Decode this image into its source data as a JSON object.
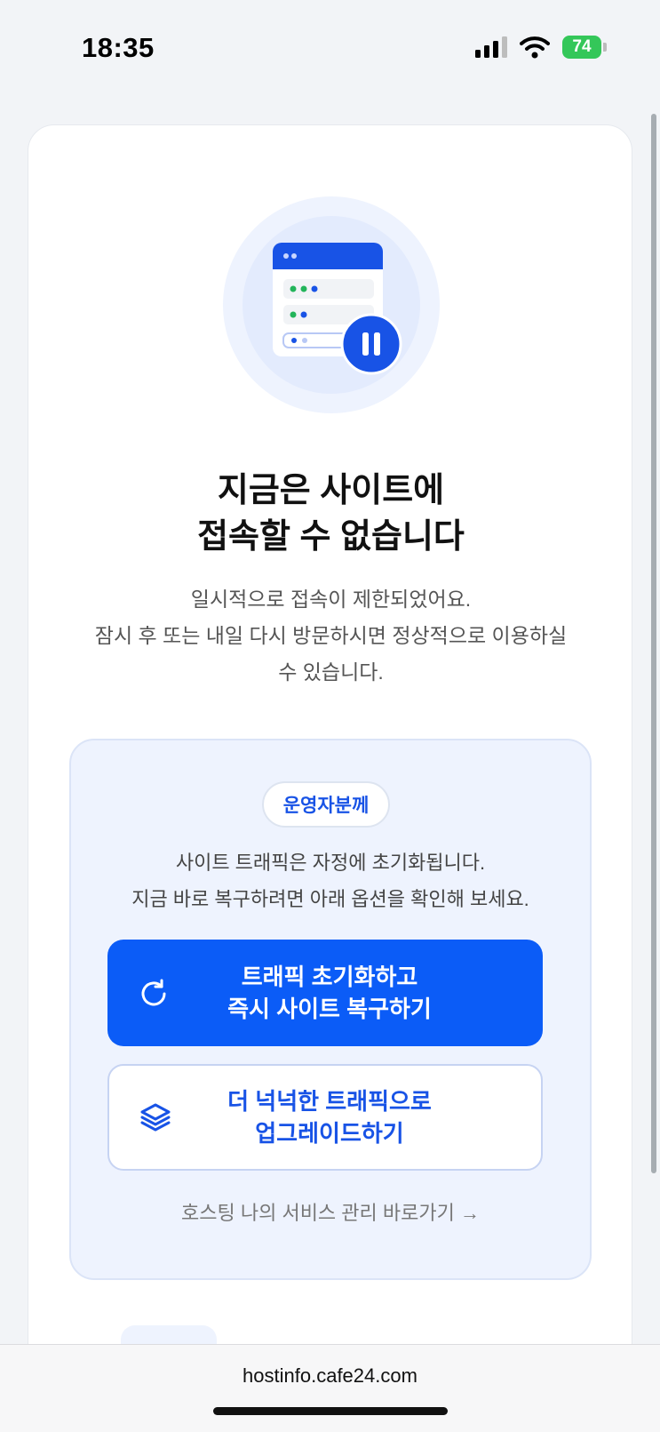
{
  "status_bar": {
    "time": "18:35",
    "battery": "74",
    "icons": [
      "signal-icon",
      "wifi-icon",
      "battery-charging-icon"
    ]
  },
  "hero": {
    "icon": "paused-browser-window-icon"
  },
  "title": {
    "line1": "지금은 사이트에",
    "line2": "접속할 수 없습니다"
  },
  "description": {
    "line1": "일시적으로 접속이 제한되었어요.",
    "line2": "잠시 후 또는 내일 다시 방문하시면 정상적으로 이용하실",
    "line3": "수 있습니다."
  },
  "operator": {
    "badge": "운영자분께",
    "line1": "사이트 트래픽은 자정에 초기화됩니다.",
    "line2": "지금 바로 복구하려면 아래 옵션을 확인해 보세요.",
    "reset_button": {
      "line1": "트래픽 초기화하고",
      "line2": "즉시 사이트 복구하기",
      "icon": "refresh-icon"
    },
    "upgrade_button": {
      "line1": "더 넉넉한 트래픽으로",
      "line2": "업그레이드하기",
      "icon": "layers-icon"
    },
    "manage_link": "호스팅 나의 서비스 관리 바로가기 →"
  },
  "browser": {
    "url": "hostinfo.cafe24.com"
  },
  "colors": {
    "primary": "#0b5cf7",
    "accent_text": "#1853e6",
    "panel_bg": "#eef3fe",
    "battery": "#34c759"
  }
}
